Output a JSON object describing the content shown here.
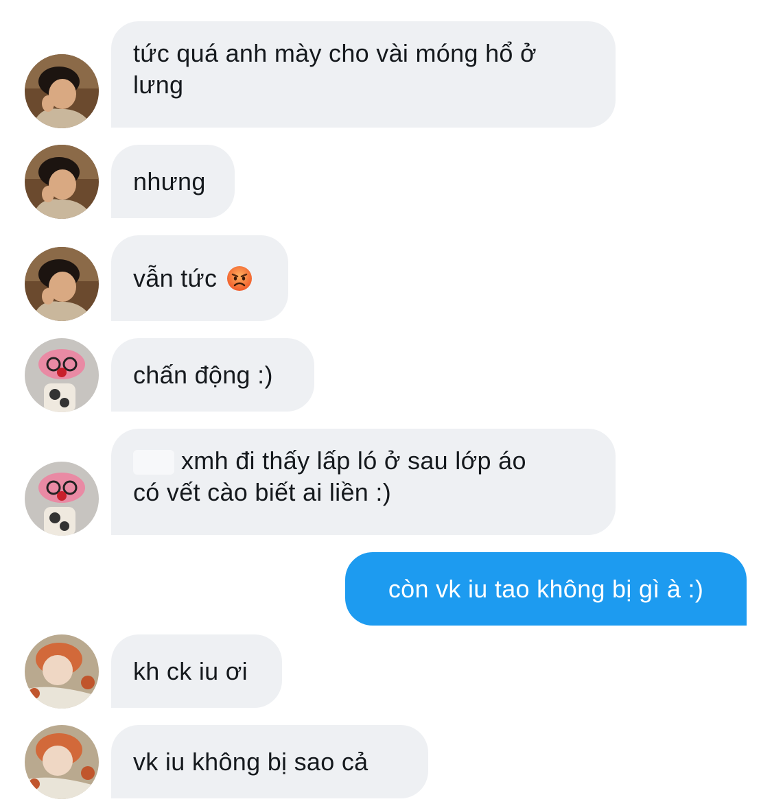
{
  "conversation": {
    "messages": [
      {
        "sender": "boy",
        "direction": "incoming",
        "lines": [
          "tức quá anh mày cho vài móng hổ ở",
          "lưng"
        ]
      },
      {
        "sender": "boy",
        "direction": "incoming",
        "text": "nhưng"
      },
      {
        "sender": "boy",
        "direction": "incoming",
        "text": "vẫn tức",
        "emoji": "angry-face"
      },
      {
        "sender": "plush",
        "direction": "incoming",
        "text": "chấn động :)"
      },
      {
        "sender": "plush",
        "direction": "incoming",
        "lines": [
          "xmh đi thấy lấp ló ở sau lớp áo",
          "có vết cào biết ai liền :)"
        ]
      },
      {
        "sender": "me",
        "direction": "outgoing",
        "text": "còn vk iu tao không bị gì à :)"
      },
      {
        "sender": "redhair",
        "direction": "incoming",
        "text": "kh ck iu ơi"
      },
      {
        "sender": "redhair",
        "direction": "incoming",
        "text": "vk iu không bị sao cả"
      }
    ]
  },
  "colors": {
    "incoming_bubble": "#eef0f3",
    "outgoing_bubble": "#1d9bf0",
    "incoming_text": "#15191d",
    "outgoing_text": "#ffffff"
  }
}
